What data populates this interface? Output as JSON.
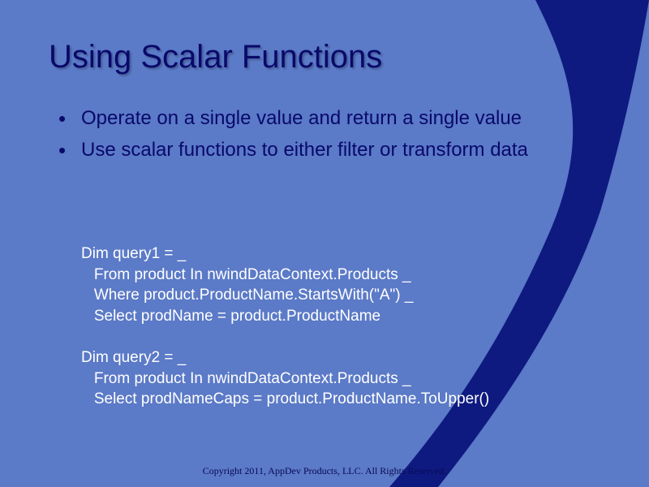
{
  "title": "Using Scalar Functions",
  "bullets": [
    "Operate on a single value and return a single value",
    "Use scalar functions to either filter or transform data"
  ],
  "code": "Dim query1 = _\n   From product In nwindDataContext.Products _\n   Where product.ProductName.StartsWith(\"A\") _\n   Select prodName = product.ProductName\n\nDim query2 = _\n   From product In nwindDataContext.Products _\n   Select prodNameCaps = product.ProductName.ToUpper()",
  "footer": "Copyright 2011, AppDev Products, LLC.    All Rights Reserved."
}
